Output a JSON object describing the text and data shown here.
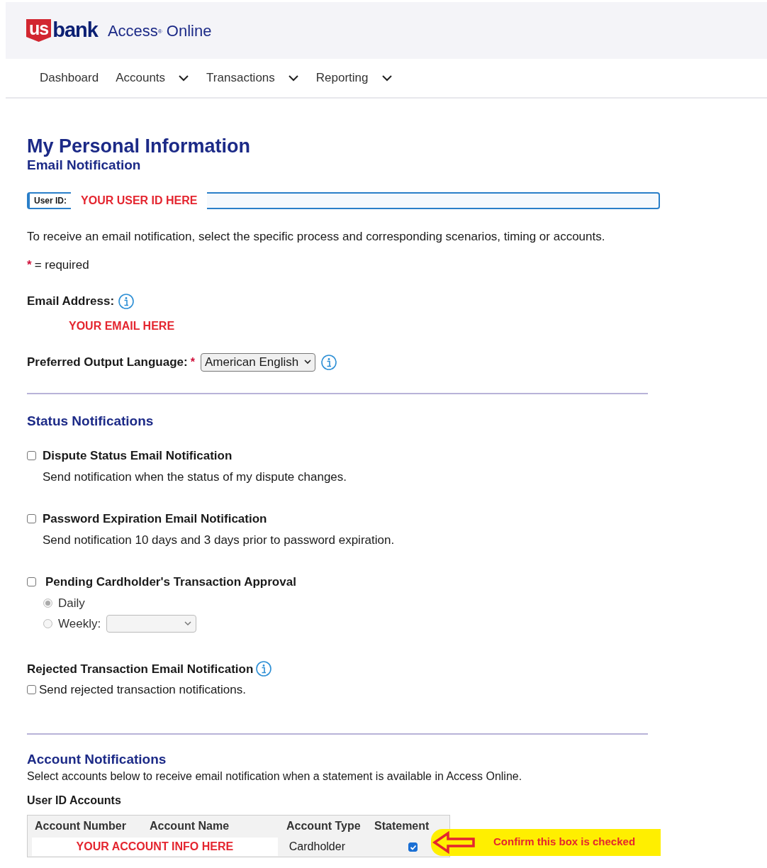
{
  "header": {
    "logo_mark": "us",
    "logo_word": "bank",
    "product": "Access",
    "product_mark": "®",
    "product_name": "Online"
  },
  "nav": [
    {
      "label": "Dashboard",
      "dropdown": false
    },
    {
      "label": "Accounts",
      "dropdown": true
    },
    {
      "label": "Transactions",
      "dropdown": true
    },
    {
      "label": "Reporting",
      "dropdown": true
    }
  ],
  "page_title": "My Personal Information",
  "page_subtitle": "Email Notification",
  "user_id": {
    "label": "User ID:",
    "value": "YOUR USER ID HERE"
  },
  "intro": "To receive an email notification, select the specific process and corresponding scenarios, timing or accounts.",
  "required_note": {
    "mark": "*",
    "text": "= required"
  },
  "email": {
    "label": "Email Address:",
    "value": "YOUR EMAIL HERE"
  },
  "language": {
    "label": "Preferred Output Language:",
    "mark": "*",
    "value": "American English"
  },
  "status_section": {
    "title": "Status Notifications",
    "items": [
      {
        "kind": "checkbox",
        "label": "Dispute Status Email Notification",
        "checked": false,
        "description": "Send notification when the status of my dispute changes."
      },
      {
        "kind": "checkbox",
        "label": "Password Expiration Email Notification",
        "checked": false,
        "description": "Send notification 10 days and 3 days prior to password expiration."
      },
      {
        "kind": "approval",
        "label": "Pending Cardholder's Transaction Approval",
        "checked": false,
        "options": [
          {
            "label": "Daily",
            "selected": true,
            "disabled": true,
            "select": false
          },
          {
            "label": "Weekly:",
            "selected": false,
            "disabled": true,
            "select": true
          }
        ]
      },
      {
        "kind": "info",
        "label": "Rejected Transaction Email Notification",
        "checkbox_label": "Send rejected transaction notifications.",
        "checked": false
      }
    ]
  },
  "account_section": {
    "title": "Account Notifications",
    "description": "Select accounts below to receive email notification when a statement is available in Access Online.",
    "table_title": "User ID Accounts",
    "columns": [
      "Account Number",
      "Account Name",
      "Account Type",
      "Statement"
    ],
    "rows": [
      {
        "account": "YOUR ACCOUNT INFO HERE",
        "type": "Cardholder",
        "statement": true
      }
    ]
  },
  "callout": "Confirm this box is checked"
}
